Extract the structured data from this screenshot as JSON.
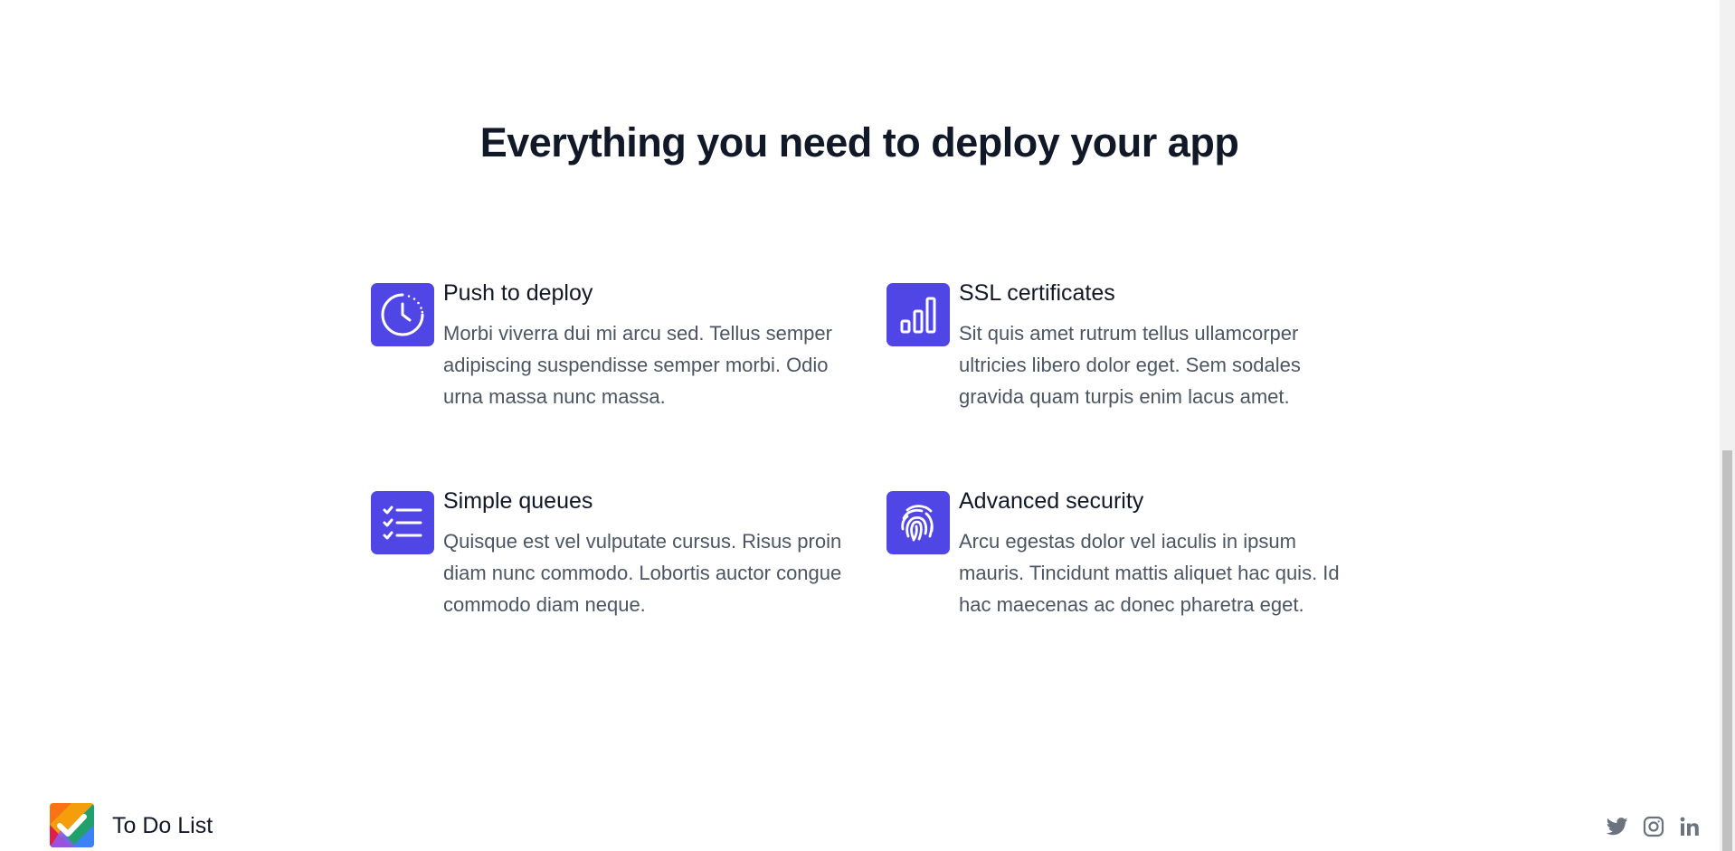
{
  "section": {
    "title": "Everything you need to deploy your app"
  },
  "features": [
    {
      "title": "Push to deploy",
      "description": "Morbi viverra dui mi arcu sed. Tellus semper adipiscing suspendisse semper morbi. Odio urna massa nunc massa.",
      "icon": "clock-icon"
    },
    {
      "title": "SSL certificates",
      "description": "Sit quis amet rutrum tellus ullamcorper ultricies libero dolor eget. Sem sodales gravida quam turpis enim lacus amet.",
      "icon": "bar-chart-icon"
    },
    {
      "title": "Simple queues",
      "description": "Quisque est vel vulputate cursus. Risus proin diam nunc commodo. Lobortis auctor congue commodo diam neque.",
      "icon": "checklist-icon"
    },
    {
      "title": "Advanced security",
      "description": "Arcu egestas dolor vel iaculis in ipsum mauris. Tincidunt mattis aliquet hac quis. Id hac maecenas ac donec pharetra eget.",
      "icon": "fingerprint-icon"
    }
  ],
  "footer": {
    "brand_name": "To Do List",
    "socials": [
      {
        "icon": "twitter-icon"
      },
      {
        "icon": "instagram-icon"
      },
      {
        "icon": "linkedin-icon"
      }
    ]
  },
  "colors": {
    "accent": "#4f46e5",
    "heading": "#111827",
    "body_text": "#4b5563",
    "social_icon": "#6b7280"
  }
}
